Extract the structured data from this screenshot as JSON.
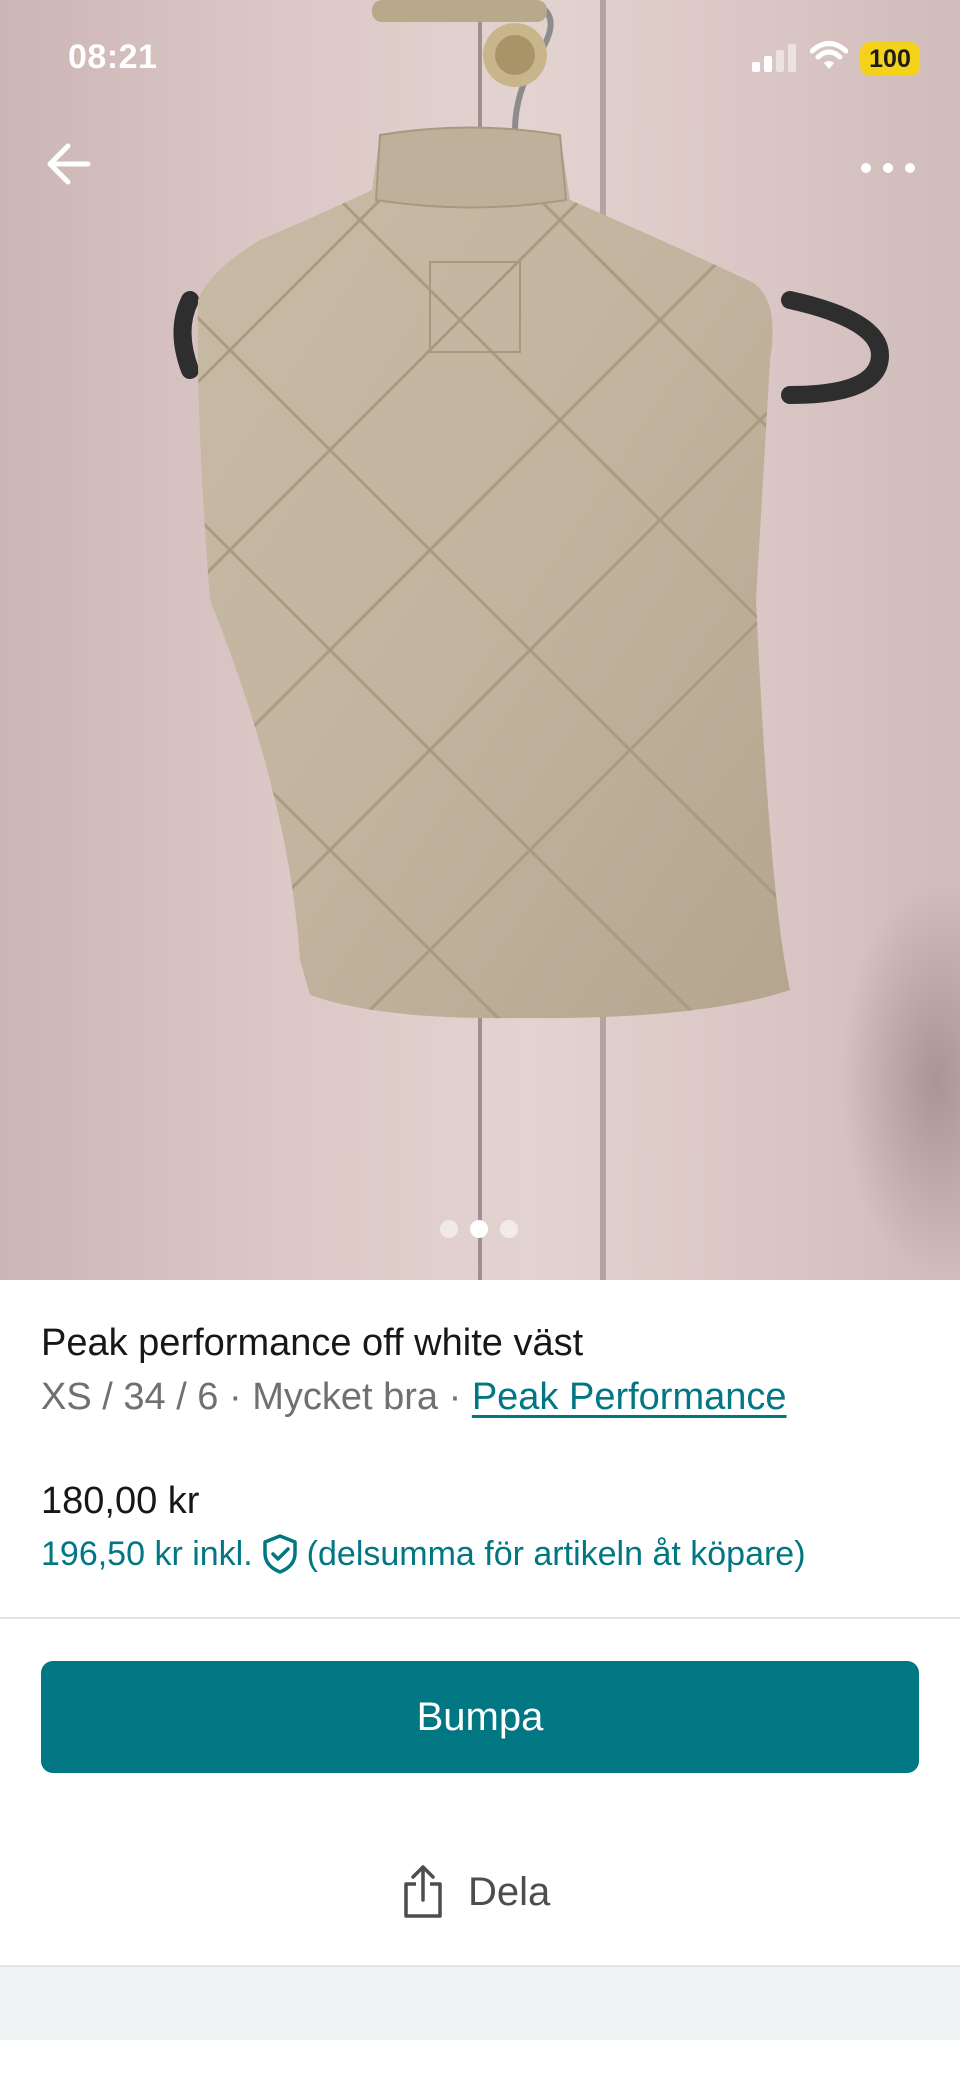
{
  "status_bar": {
    "time": "08:21",
    "battery": "100",
    "signal_icon": "cellular-signal-icon",
    "wifi_icon": "wifi-icon"
  },
  "header": {
    "back_icon": "arrow-left-icon",
    "more_icon": "more-horizontal-icon"
  },
  "gallery": {
    "image": "beige quilted down vest on hanger",
    "total_images": 3,
    "active_index": 1
  },
  "item": {
    "title": "Peak performance off white väst",
    "details": "XS / 34 / 6 · Mycket bra · ",
    "brand": "Peak Performance",
    "price": "180,00 kr",
    "price_incl": "196,50 kr inkl.",
    "price_incl_note": "(delsumma för artikeln åt köpare)",
    "protection_icon": "shield-check-icon"
  },
  "actions": {
    "bump_label": "Bumpa",
    "share_label": "Dela",
    "share_icon": "share-icon"
  },
  "colors": {
    "accent": "#007782",
    "text": "#171717",
    "muted": "#707070",
    "battery": "#f4d21a"
  }
}
